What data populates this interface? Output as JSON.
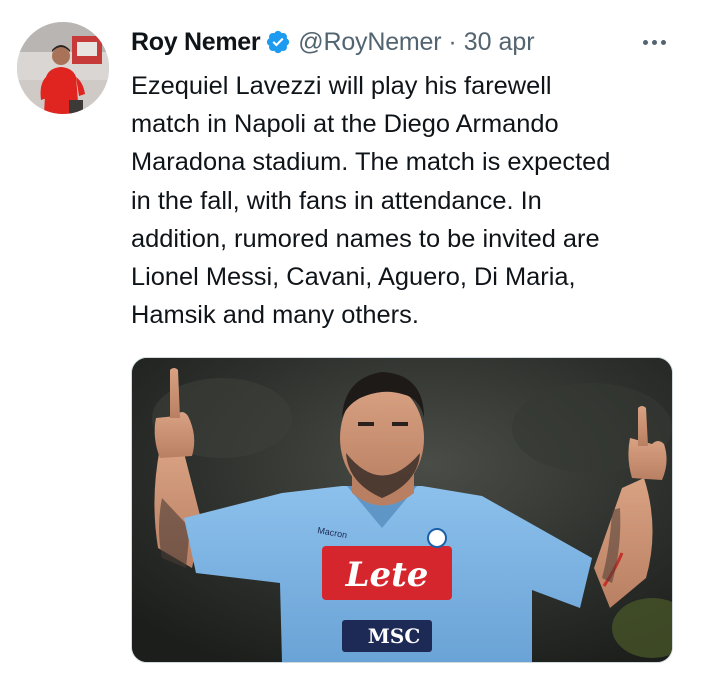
{
  "tweet": {
    "author": {
      "name": "Roy Nemer",
      "handle": "@RoyNemer",
      "verified_icon": "verified-badge-icon",
      "avatar_icon": "profile-avatar"
    },
    "separator": "·",
    "date": "30 apr",
    "more_icon": "more-options-icon",
    "text_lines": [
      "Ezequiel Lavezzi will play his farewell",
      "match in Napoli at the Diego Armando",
      "Maradona stadium. The match is expected",
      "in the fall, with fans in attendance. In",
      "addition, rumored names to be invited are",
      "Lionel Messi, Cavani, Aguero, Di Maria,",
      "Hamsik and many others."
    ],
    "media": {
      "jersey_sponsor": "Lete",
      "jersey_sub_sponsor": "MSC",
      "jersey_brand": "Macron"
    }
  },
  "colors": {
    "text_primary": "#0f1419",
    "text_secondary": "#536471",
    "verified_blue": "#1d9bf0",
    "jersey_blue": "#7fb6e6",
    "sponsor_red": "#d6262d"
  }
}
